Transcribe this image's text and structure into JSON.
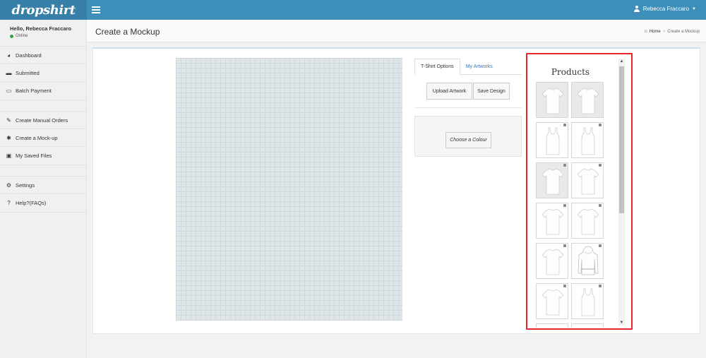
{
  "brand": {
    "logo_text": "dropshirt",
    "header_color": "#3d8eb9",
    "logo_bg": "#367fa9"
  },
  "topbar": {
    "user_name": "Rebecca Fraccaro"
  },
  "sidebar": {
    "greeting": "Hello, Rebecca Fraccaro",
    "status": "Online",
    "group1": [
      {
        "label": "Dashboard",
        "icon": "dashboard-icon"
      },
      {
        "label": "Submitted",
        "icon": "folder-icon"
      },
      {
        "label": "Batch Payment",
        "icon": "credit-card-icon"
      }
    ],
    "group2": [
      {
        "label": "Create Manual Orders",
        "icon": "edit-icon"
      },
      {
        "label": "Create a Mock-up",
        "icon": "asterisk-icon"
      },
      {
        "label": "My Saved Files",
        "icon": "save-icon"
      }
    ],
    "group3": [
      {
        "label": "Settings",
        "icon": "gear-icon"
      },
      {
        "label": "Help?(FAQs)",
        "icon": "question-icon"
      }
    ]
  },
  "header": {
    "title": "Create a Mockup",
    "breadcrumb_home": "Home",
    "breadcrumb_current": "Create a Mockup"
  },
  "designer": {
    "tabs": [
      {
        "label": "T-Shirt Options"
      },
      {
        "label": "My Artworks"
      }
    ],
    "upload_label": "Upload Artwork",
    "save_label": "Save Design",
    "colour_label": "Choose a Colour"
  },
  "products": {
    "title": "Products",
    "accent": "#e8262d",
    "items": [
      {
        "name": "crew-tee",
        "bg": "grey"
      },
      {
        "name": "crew-tee",
        "bg": "grey"
      },
      {
        "name": "tank-top",
        "bg": "white"
      },
      {
        "name": "tank-top",
        "bg": "white"
      },
      {
        "name": "crew-tee",
        "bg": "grey"
      },
      {
        "name": "crew-tee",
        "bg": "white"
      },
      {
        "name": "crew-tee",
        "bg": "white"
      },
      {
        "name": "crew-tee",
        "bg": "white"
      },
      {
        "name": "crew-tee",
        "bg": "white"
      },
      {
        "name": "hoodie",
        "bg": "white"
      },
      {
        "name": "crew-tee",
        "bg": "white"
      },
      {
        "name": "tank-top",
        "bg": "white"
      }
    ]
  }
}
